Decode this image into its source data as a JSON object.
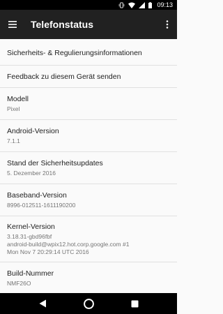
{
  "status_bar": {
    "time": "09:13",
    "icons": [
      "vibrate-icon",
      "wifi-icon",
      "cell-signal-icon",
      "battery-icon"
    ]
  },
  "toolbar": {
    "title": "Telefonstatus",
    "menu_icon": "hamburger-menu-icon",
    "overflow_icon": "more-vert-icon"
  },
  "rows": [
    {
      "primary": "Sicherheits- & Regulierungsinformationen",
      "secondary": ""
    },
    {
      "primary": "Feedback zu diesem Gerät senden",
      "secondary": ""
    },
    {
      "primary": "Modell",
      "secondary": "Pixel"
    },
    {
      "primary": "Android-Version",
      "secondary": "7.1.1"
    },
    {
      "primary": "Stand der Sicherheitsupdates",
      "secondary": "5. Dezember 2016"
    },
    {
      "primary": "Baseband-Version",
      "secondary": "8996-012511-1611190200"
    },
    {
      "primary": "Kernel-Version",
      "secondary": "3.18.31-gbd96fbf\nandroid-build@wpix12.hot.corp.google.com #1\nMon Nov 7 20:29:14 UTC 2016"
    },
    {
      "primary": "Build-Nummer",
      "secondary": "NMF26O"
    }
  ],
  "nav_bar": {
    "back_icon": "back-icon",
    "home_icon": "home-icon",
    "recents_icon": "recents-icon"
  }
}
